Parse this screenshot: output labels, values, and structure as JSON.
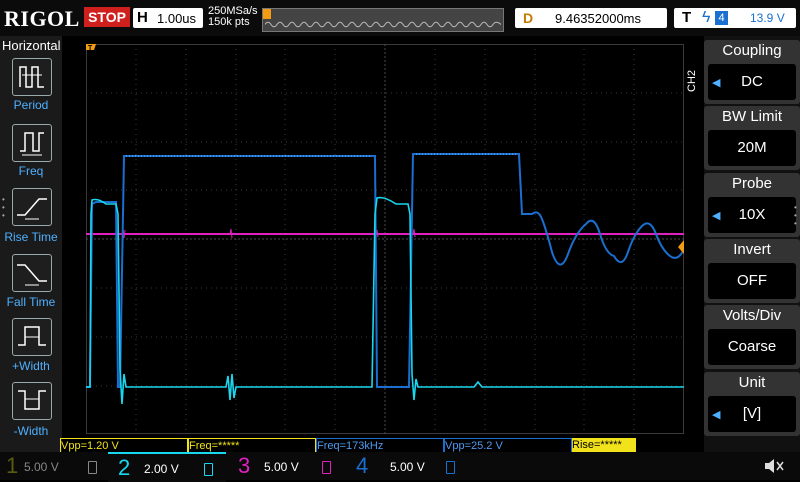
{
  "topbar": {
    "logo": "RIGOL",
    "run_state": "STOP",
    "timebase_label": "H",
    "timebase_value": "1.00us",
    "sample_rate": "250MSa/s",
    "memory_depth": "150k pts",
    "delay_label": "D",
    "delay_value": "9.46352000ms",
    "trigger_label": "T",
    "trigger_source": "4",
    "trigger_level": "13.9 V"
  },
  "left_menu": {
    "title": "Horizontal",
    "items": [
      {
        "label": "Period",
        "icon": "period-icon"
      },
      {
        "label": "Freq",
        "icon": "freq-icon"
      },
      {
        "label": "Rise Time",
        "icon": "rise-time-icon"
      },
      {
        "label": "Fall Time",
        "icon": "fall-time-icon"
      },
      {
        "label": "+Width",
        "icon": "positive-width-icon"
      },
      {
        "label": "-Width",
        "icon": "negative-width-icon"
      }
    ]
  },
  "right_menu": {
    "channel_tag": "CH2",
    "items": [
      {
        "title": "Coupling",
        "value": "DC",
        "has_arrow": true
      },
      {
        "title": "BW Limit",
        "value": "20M",
        "has_arrow": false
      },
      {
        "title": "Probe",
        "value": "10X",
        "has_arrow": true
      },
      {
        "title": "Invert",
        "value": "OFF",
        "has_arrow": false
      },
      {
        "title": "Volts/Div",
        "value": "Coarse",
        "has_arrow": false
      },
      {
        "title": "Unit",
        "value": "[V]",
        "has_arrow": true
      }
    ]
  },
  "measurements": [
    {
      "text": "Vpp=1.20 V",
      "color": "#f2e21b"
    },
    {
      "text": "Freq=*****",
      "color": "#f2e21b"
    },
    {
      "text": "Freq=173kHz",
      "color": "#1a6fd0"
    },
    {
      "text": "Vpp=25.2 V",
      "color": "#1a6fd0"
    },
    {
      "text": "Rise=*****",
      "color": "#000000"
    }
  ],
  "channels": [
    {
      "number": "1",
      "scale": "5.00 V",
      "color": "#5a5a10"
    },
    {
      "number": "2",
      "scale": "2.00 V",
      "color": "#18d8f0"
    },
    {
      "number": "3",
      "scale": "5.00 V",
      "color": "#e020c0"
    },
    {
      "number": "4",
      "scale": "5.00 V",
      "color": "#1a6fd0"
    }
  ],
  "markers": {
    "ch2": "2",
    "trigger_left": "T",
    "trigger_right": "T"
  },
  "colors": {
    "ch1": "#f2e21b",
    "ch2": "#18d8f0",
    "ch3": "#e020c0",
    "ch4": "#1a6fd0",
    "stop": "#d0201e",
    "trigger_marker": "#f39c12",
    "grid": "#3a3a3a"
  }
}
